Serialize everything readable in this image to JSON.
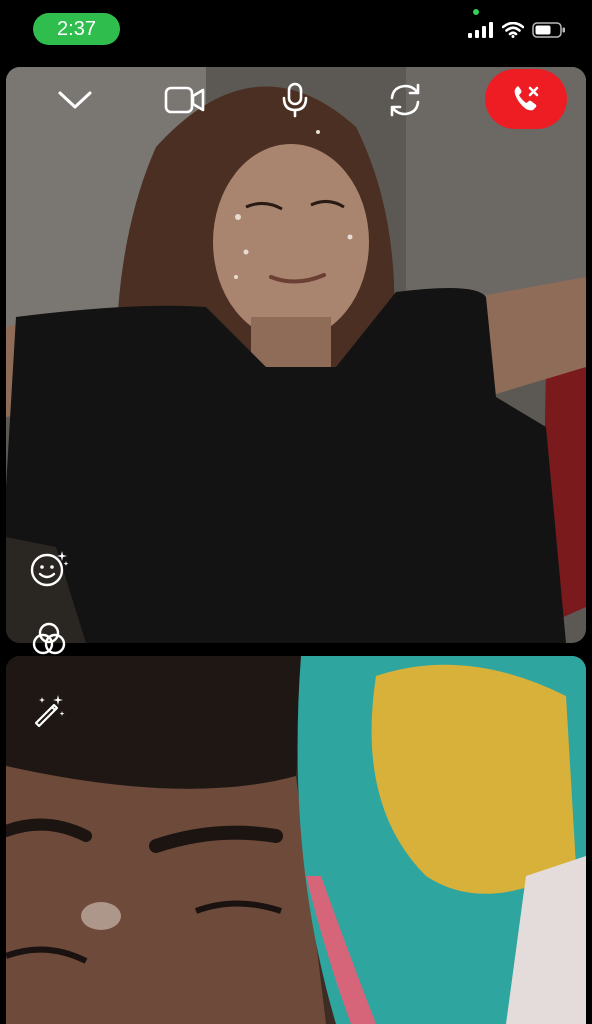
{
  "status_bar": {
    "time": "2:37",
    "icons": [
      "signal-icon",
      "wifi-icon",
      "battery-icon"
    ]
  },
  "call_controls": {
    "icons": [
      "chevron-down-icon",
      "video-camera-icon",
      "microphone-icon",
      "switch-camera-icon",
      "end-call-icon"
    ]
  },
  "side_tools": {
    "icons": [
      "face-effects-icon",
      "filters-icon",
      "magic-wand-icon"
    ]
  },
  "colors": {
    "end_call": "#ee1d24",
    "time_pill": "#2fbe4e",
    "background": "#000000"
  }
}
